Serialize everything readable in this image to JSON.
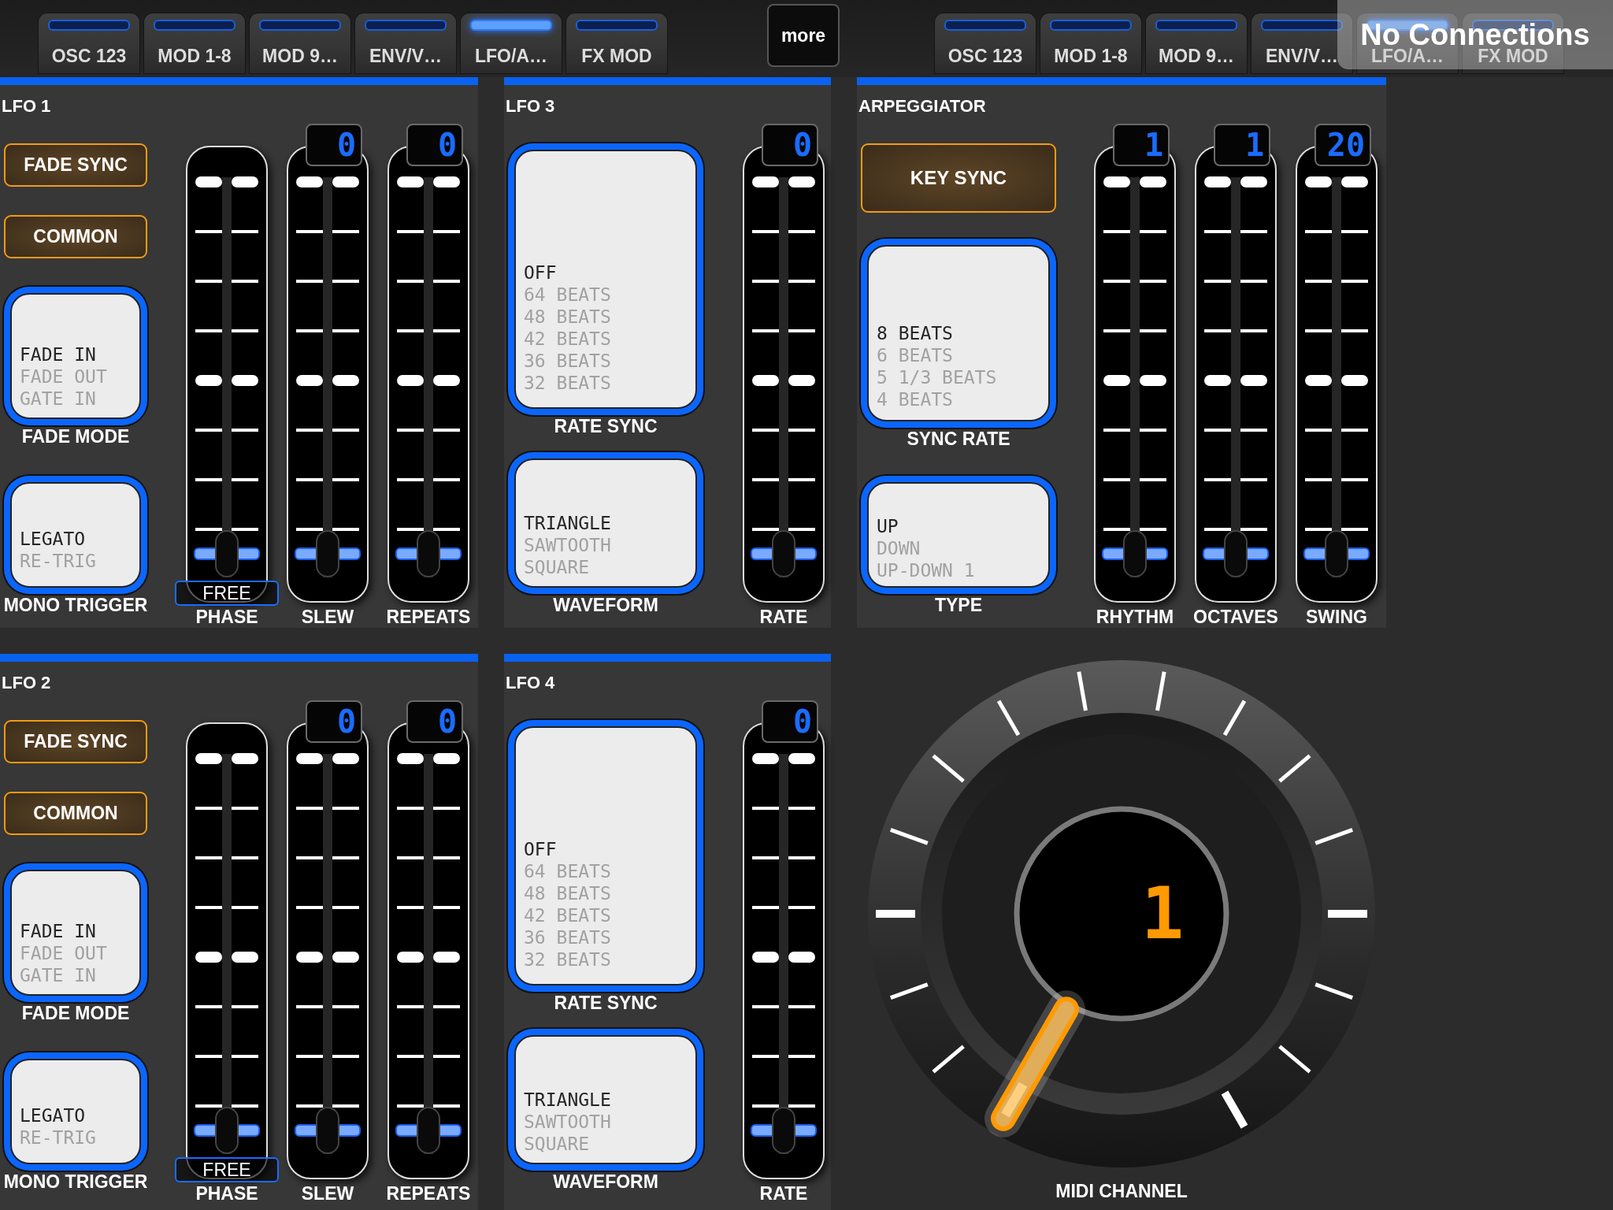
{
  "tab_bar": {
    "tabs": [
      {
        "label": "OSC 123",
        "selected": false
      },
      {
        "label": "MOD 1-8",
        "selected": false
      },
      {
        "label": "MOD 9…",
        "selected": false
      },
      {
        "label": "ENV/V…",
        "selected": false
      },
      {
        "label": "LFO/A…",
        "selected": true
      },
      {
        "label": "FX MOD",
        "selected": false
      }
    ],
    "more_button": "more",
    "mirror_tabs": [
      {
        "label": "OSC 123",
        "selected": false
      },
      {
        "label": "MOD 1-8",
        "selected": false
      },
      {
        "label": "MOD 9…",
        "selected": false
      },
      {
        "label": "ENV/V…",
        "selected": false
      },
      {
        "label": "LFO/A…",
        "selected": true
      },
      {
        "label": "FX MOD",
        "selected": false
      }
    ],
    "status": "No Connections"
  },
  "rows": [
    {
      "panels": [
        {
          "kind": "lfo_fade",
          "title": "LFO 1",
          "buttons": [
            {
              "label": "FADE SYNC"
            },
            {
              "label": "COMMON"
            }
          ],
          "pickers": [
            {
              "label": "FADE MODE",
              "items": [
                {
                  "text": "FADE IN",
                  "selected": true
                },
                {
                  "text": "FADE OUT",
                  "selected": false
                },
                {
                  "text": "GATE IN",
                  "selected": false
                }
              ]
            },
            {
              "label": "MONO TRIGGER",
              "items": [
                {
                  "text": "LEGATO",
                  "selected": true
                },
                {
                  "text": "RE-TRIG",
                  "selected": false
                }
              ]
            }
          ],
          "faders": [
            {
              "label": "PHASE",
              "badge": "FREE",
              "level": 0
            },
            {
              "label": "SLEW",
              "display": "0",
              "level": 0
            },
            {
              "label": "REPEATS",
              "display": "0",
              "level": 0
            }
          ]
        },
        {
          "kind": "lfo_sync",
          "title": "LFO 3",
          "pickers": [
            {
              "label": "RATE SYNC",
              "items": [
                {
                  "text": "OFF",
                  "selected": true
                },
                {
                  "text": "64 BEATS",
                  "selected": false
                },
                {
                  "text": "48 BEATS",
                  "selected": false
                },
                {
                  "text": "42 BEATS",
                  "selected": false
                },
                {
                  "text": "36 BEATS",
                  "selected": false
                },
                {
                  "text": "32 BEATS",
                  "selected": false
                }
              ]
            },
            {
              "label": "WAVEFORM",
              "items": [
                {
                  "text": "TRIANGLE",
                  "selected": true
                },
                {
                  "text": "SAWTOOTH",
                  "selected": false
                },
                {
                  "text": "SQUARE",
                  "selected": false
                }
              ]
            }
          ],
          "faders": [
            {
              "label": "RATE",
              "display": "0",
              "level": 0
            }
          ]
        },
        {
          "kind": "arp",
          "title": "ARPEGGIATOR",
          "buttons": [
            {
              "label": "KEY SYNC"
            }
          ],
          "pickers": [
            {
              "label": "SYNC RATE",
              "items": [
                {
                  "text": "8 BEATS",
                  "selected": true
                },
                {
                  "text": "6 BEATS",
                  "selected": false
                },
                {
                  "text": "5 1/3 BEATS",
                  "selected": false
                },
                {
                  "text": "4 BEATS",
                  "selected": false
                }
              ]
            },
            {
              "label": "TYPE",
              "items": [
                {
                  "text": "UP",
                  "selected": true
                },
                {
                  "text": "DOWN",
                  "selected": false
                },
                {
                  "text": "UP-DOWN 1",
                  "selected": false
                }
              ]
            }
          ],
          "faders": [
            {
              "label": "RHYTHM",
              "display": "1",
              "level": 0
            },
            {
              "label": "OCTAVES",
              "display": "1",
              "level": 0
            },
            {
              "label": "SWING",
              "display": "20",
              "level": 0
            }
          ]
        }
      ]
    },
    {
      "panels": [
        {
          "kind": "lfo_fade",
          "title": "LFO 2",
          "buttons": [
            {
              "label": "FADE SYNC"
            },
            {
              "label": "COMMON"
            }
          ],
          "pickers": [
            {
              "label": "FADE MODE",
              "items": [
                {
                  "text": "FADE IN",
                  "selected": true
                },
                {
                  "text": "FADE OUT",
                  "selected": false
                },
                {
                  "text": "GATE IN",
                  "selected": false
                }
              ]
            },
            {
              "label": "MONO TRIGGER",
              "items": [
                {
                  "text": "LEGATO",
                  "selected": true
                },
                {
                  "text": "RE-TRIG",
                  "selected": false
                }
              ]
            }
          ],
          "faders": [
            {
              "label": "PHASE",
              "badge": "FREE",
              "level": 0
            },
            {
              "label": "SLEW",
              "display": "0",
              "level": 0
            },
            {
              "label": "REPEATS",
              "display": "0",
              "level": 0
            }
          ]
        },
        {
          "kind": "lfo_sync",
          "title": "LFO 4",
          "pickers": [
            {
              "label": "RATE SYNC",
              "items": [
                {
                  "text": "OFF",
                  "selected": true
                },
                {
                  "text": "64 BEATS",
                  "selected": false
                },
                {
                  "text": "48 BEATS",
                  "selected": false
                },
                {
                  "text": "42 BEATS",
                  "selected": false
                },
                {
                  "text": "36 BEATS",
                  "selected": false
                },
                {
                  "text": "32 BEATS",
                  "selected": false
                }
              ]
            },
            {
              "label": "WAVEFORM",
              "items": [
                {
                  "text": "TRIANGLE",
                  "selected": true
                },
                {
                  "text": "SAWTOOTH",
                  "selected": false
                },
                {
                  "text": "SQUARE",
                  "selected": false
                }
              ]
            }
          ],
          "faders": [
            {
              "label": "RATE",
              "display": "0",
              "level": 0
            }
          ]
        },
        {
          "kind": "knob",
          "label": "MIDI CHANNEL",
          "display": "1"
        }
      ]
    }
  ]
}
